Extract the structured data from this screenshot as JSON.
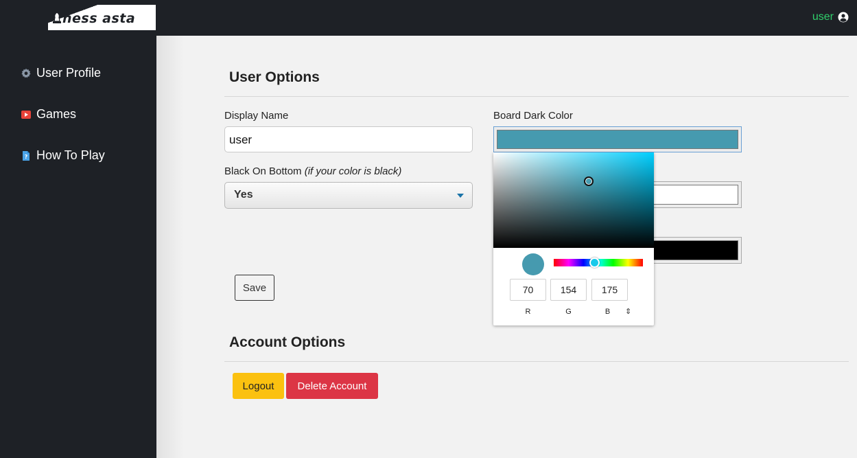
{
  "header": {
    "logo_text": "hess asta",
    "user_name": "user"
  },
  "sidebar": {
    "items": [
      {
        "label": "User Profile",
        "icon": "gear-icon"
      },
      {
        "label": "Games",
        "icon": "play-icon"
      },
      {
        "label": "How To Play",
        "icon": "help-doc-icon"
      }
    ]
  },
  "user_options": {
    "title": "User Options",
    "display_name_label": "Display Name",
    "display_name_value": "user",
    "black_on_bottom_label": "Black On Bottom",
    "black_on_bottom_hint": "(if your color is black)",
    "black_on_bottom_value": "Yes",
    "board_dark_color_label": "Board Dark Color",
    "board_dark_color": "#469aaf",
    "board_light_color": "#ffffff",
    "third_color": "#000000",
    "save_label": "Save"
  },
  "color_picker": {
    "r": "70",
    "g": "154",
    "b": "175",
    "r_label": "R",
    "g_label": "G",
    "b_label": "B",
    "mode_toggle": "⇕",
    "current_color": "#469aaf"
  },
  "account_options": {
    "title": "Account Options",
    "logout_label": "Logout",
    "delete_label": "Delete Account"
  },
  "colors": {
    "topbar": "#1e2126",
    "user_accent": "#2fcf6b",
    "logout": "#fbc110",
    "delete": "#dc3545"
  }
}
